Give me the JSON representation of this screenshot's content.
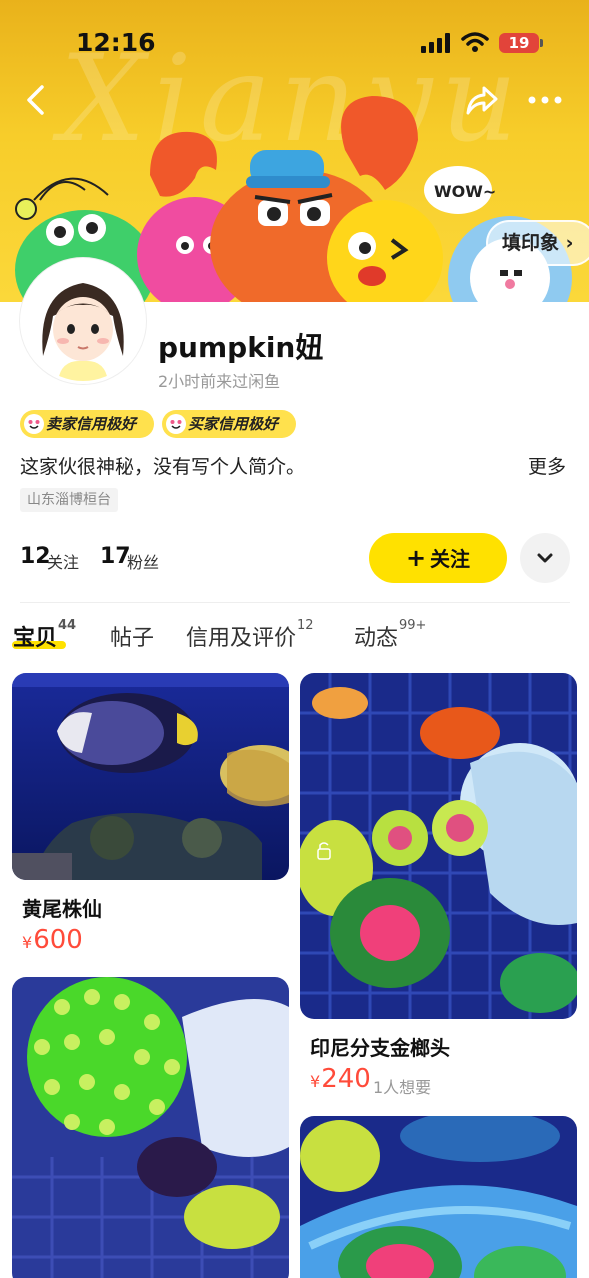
{
  "status": {
    "time": "12:16",
    "battery": "19"
  },
  "banner": {
    "impression_button": "填印象 ›"
  },
  "profile": {
    "username": "pumpkin妞",
    "last_seen": "2小时前来过闲鱼",
    "badges": [
      "卖家信用极好",
      "买家信用极好"
    ],
    "bio": "这家伙很神秘，没有写个人简介。",
    "bio_more": "更多",
    "location": "山东淄博桓台",
    "following_count": "12",
    "following_label": "关注",
    "followers_count": "17",
    "followers_label": "粉丝",
    "follow_button": "关注"
  },
  "tabs": [
    {
      "label": "宝贝",
      "count": "44"
    },
    {
      "label": "帖子",
      "count": ""
    },
    {
      "label": "信用及评价",
      "count": "12"
    },
    {
      "label": "动态",
      "count": "99+"
    }
  ],
  "products": [
    {
      "title": "黄尾株仙",
      "currency": "¥",
      "price": "600",
      "want": ""
    },
    {
      "title": "印尼分支金榔头",
      "currency": "¥",
      "price": "240",
      "want": "1人想要"
    }
  ],
  "colors": {
    "brand_yellow": "#ffe100",
    "price_red": "#ff4b3a"
  }
}
